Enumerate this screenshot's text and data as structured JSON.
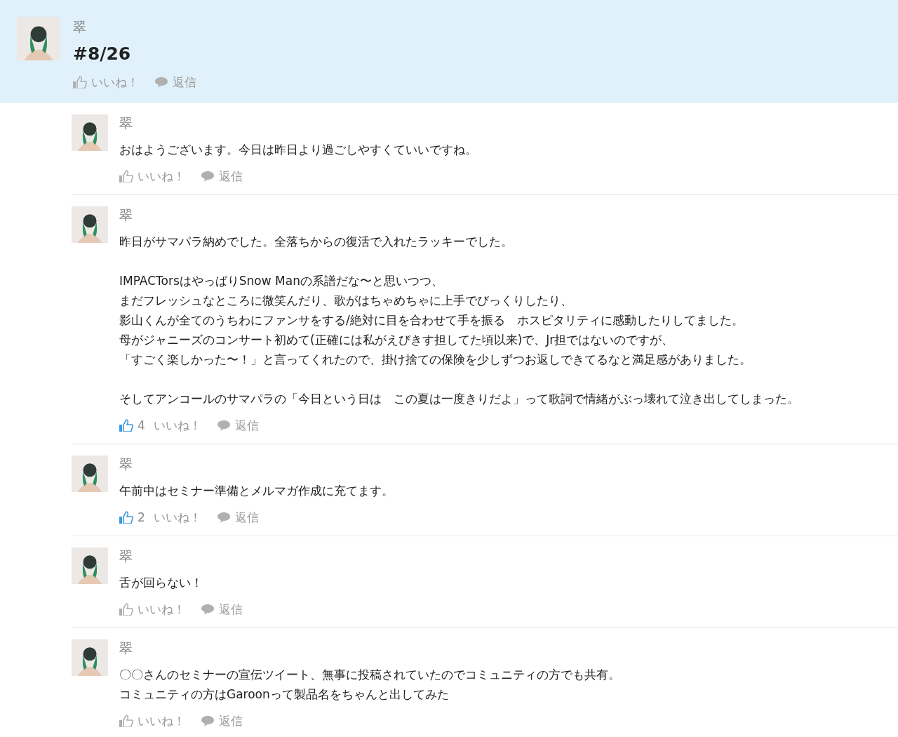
{
  "post": {
    "author": "翠",
    "title": "#8/26",
    "liked": false,
    "like_label": "いいね！",
    "reply_label": "返信"
  },
  "comments": [
    {
      "author": "翠",
      "paragraphs": [
        [
          "おはようございます。今日は昨日より過ごしやすくていいですね。"
        ]
      ],
      "liked": false,
      "like_label": "いいね！",
      "reply_label": "返信"
    },
    {
      "author": "翠",
      "paragraphs": [
        [
          "昨日がサマパラ納めでした。全落ちからの復活で入れたラッキーでした。"
        ],
        [
          "IMPACTorsはやっぱりSnow Manの系譜だな〜と思いつつ、",
          "まだフレッシュなところに微笑んだり、歌がはちゃめちゃに上手でびっくりしたり、",
          "影山くんが全てのうちわにファンサをする/絶対に目を合わせて手を振る　ホスピタリティに感動したりしてました。",
          "母がジャニーズのコンサート初めて(正確には私がえびきす担してた頃以来)で、Jr担ではないのですが、",
          "「すごく楽しかった〜！」と言ってくれたので、掛け捨ての保険を少しずつお返しできてるなと満足感がありました。"
        ],
        [
          "そしてアンコールのサマパラの「今日という日は　この夏は一度きりだよ」って歌詞で情緒がぶっ壊れて泣き出してしまった。"
        ]
      ],
      "liked": true,
      "like_count": "4",
      "like_label": "いいね！",
      "reply_label": "返信"
    },
    {
      "author": "翠",
      "paragraphs": [
        [
          "午前中はセミナー準備とメルマガ作成に充てます。"
        ]
      ],
      "liked": true,
      "like_count": "2",
      "like_label": "いいね！",
      "reply_label": "返信"
    },
    {
      "author": "翠",
      "paragraphs": [
        [
          "舌が回らない！"
        ]
      ],
      "liked": false,
      "like_label": "いいね！",
      "reply_label": "返信"
    },
    {
      "author": "翠",
      "paragraphs": [
        [
          "〇〇さんのセミナーの宣伝ツイート、無事に投稿されていたのでコミュニティの方でも共有。",
          "コミュニティの方はGaroonって製品名をちゃんと出してみた"
        ]
      ],
      "liked": false,
      "like_label": "いいね！",
      "reply_label": "返信"
    }
  ]
}
